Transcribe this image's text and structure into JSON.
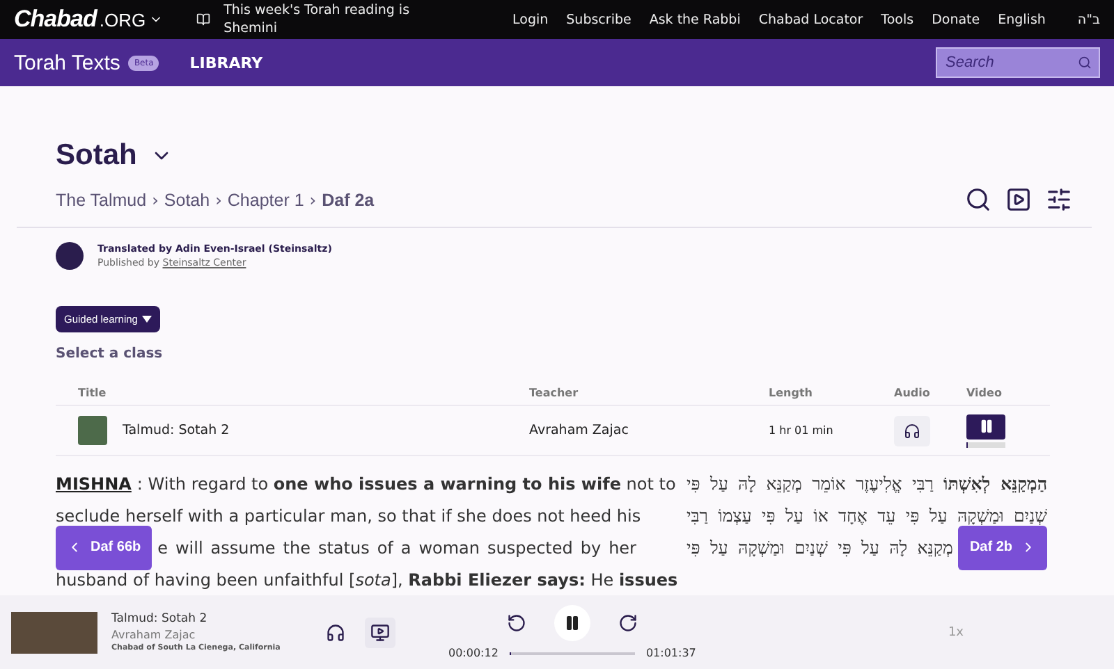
{
  "top_bar": {
    "logo": {
      "brand": "Chabad",
      "suffix": ".ORG"
    },
    "parsha_notice": "This week's Torah reading is Shemini",
    "links": [
      "Login",
      "Subscribe",
      "Ask the Rabbi",
      "Chabad Locator",
      "Tools",
      "Donate",
      "English"
    ],
    "hebrew_mark": "ב\"ה"
  },
  "nav_bar": {
    "logo": "Torah Texts",
    "badge": "Beta",
    "link": "LIBRARY",
    "search": {
      "placeholder": "Search"
    }
  },
  "header": {
    "title": "Sotah",
    "separator": "›",
    "breadcrumb": [
      {
        "label": "The Talmud",
        "current": false
      },
      {
        "label": "Sotah",
        "current": false
      },
      {
        "label": "Chapter 1",
        "current": false
      },
      {
        "label": "Daf 2a",
        "current": true
      }
    ]
  },
  "credits": {
    "translator": "Translated by Adin Even-Israel (Steinsaltz)",
    "published_prefix": "Published by",
    "publisher": "Steinsaltz Center"
  },
  "guided_learning": {
    "label": "Guided learning",
    "prompt": "Select a class"
  },
  "classes": {
    "columns": [
      "Title",
      "Teacher",
      "Length",
      "Audio",
      "Video"
    ],
    "rows": [
      {
        "title": "Talmud: Sotah 2",
        "teacher": "Avraham Zajac",
        "length": "1 hr 01 min",
        "playing": true,
        "level": 0.05
      }
    ]
  },
  "reading": {
    "english": {
      "lead": "MISHNA",
      "lines": [
        "  : With regard to **one who issues a warning to his wife** not to",
        "seclude herself with a particular man, so that if she does not heed his",
        "e will assume the status of a woman suspected by her",
        "husband of having been unfaithful [*sota*], **Rabbi Eliezer says:** He **issues**"
      ]
    },
    "hebrew": {
      "lines": [
        "**הַמְקַנֵּא לְאִשְׁתּוֹ** רַבִּי אֱלִיעֶזֶר אוֹמֵר מְקַנֵּא לָהּ עַל פִּי",
        "שְׁנַיִם וּמַשְׁקָהּ עַל פִּי עֵד אֶחָד אוֹ עַל פִּי עַצְמוֹ רַבִּי",
        "מְקַנֵּא לָהּ עַל פִּי שְׁנַיִם וּמַשְׁקָהּ עַל פִּי"
      ]
    },
    "prev": "Daf 66b",
    "next": "Daf 2b"
  },
  "player": {
    "title": "Talmud: Sotah 2",
    "teacher": "Avraham Zajac",
    "org": "Chabad of South La Cienega, California",
    "playing": true,
    "elapsed": "00:00:12",
    "total": "01:01:37",
    "level": 0.003,
    "speed": "1x"
  }
}
